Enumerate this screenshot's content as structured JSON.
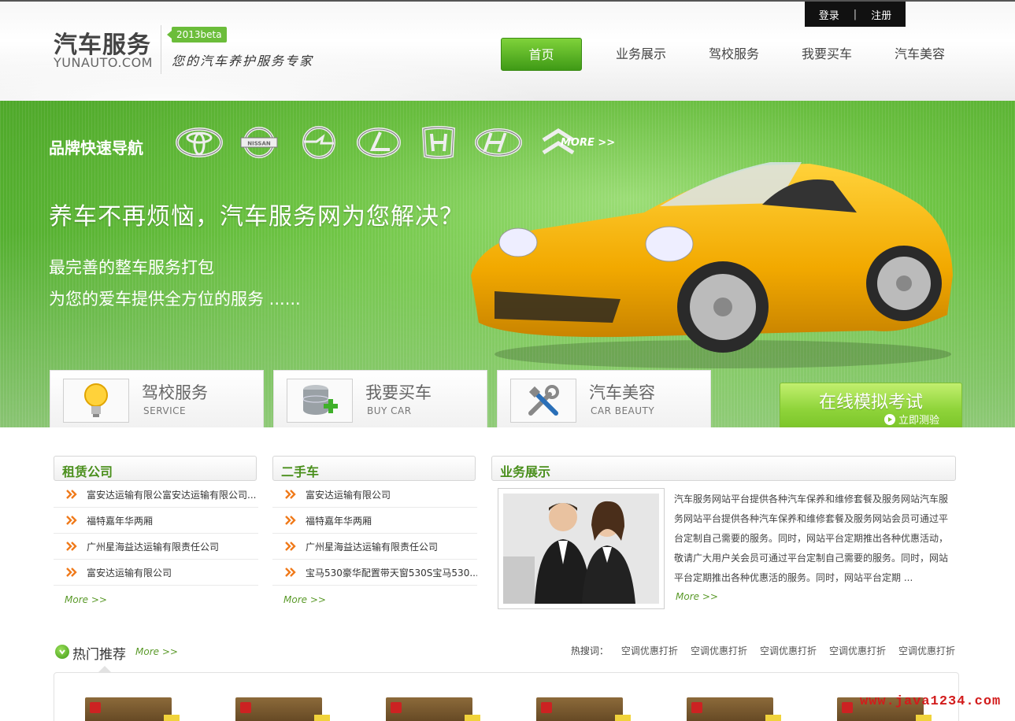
{
  "header": {
    "logo_title": "汽车服务",
    "logo_sub": "YUNAUTO.COM",
    "beta": "2013beta",
    "slogan": "您的汽车养护服务专家",
    "auth": {
      "login": "登录",
      "separator": "|",
      "register": "注册"
    },
    "nav": [
      "首页",
      "业务展示",
      "驾校服务",
      "我要买车",
      "汽车美容"
    ]
  },
  "banner": {
    "brand_title": "品牌快速导航",
    "brand_more": "MORE >>",
    "brands": [
      "toyota-logo-icon",
      "nissan-logo-icon",
      "opel-logo-icon",
      "lexus-logo-icon",
      "honda-logo-icon",
      "hyundai-logo-icon",
      "citroen-logo-icon"
    ],
    "nissan_word": "NISSAN",
    "headline": "养车不再烦恼，汽车服务网为您解决？",
    "line1": "最完善的整车服务打包",
    "line2": "为您的爱车提供全方位的服务 ......",
    "services": [
      {
        "title": "驾校服务",
        "sub": "SERVICE",
        "icon": "lightbulb-icon"
      },
      {
        "title": "我要买车",
        "sub": "BUY CAR",
        "icon": "database-add-icon"
      },
      {
        "title": "汽车美容",
        "sub": "CAR BEAUTY",
        "icon": "tools-icon"
      }
    ],
    "exam": {
      "title": "在线模拟考试",
      "sub": "立即测验"
    }
  },
  "rental": {
    "title": "租赁公司",
    "items": [
      "富安达运输有限公富安达运输有限公司...",
      "福特嘉年华两厢",
      "广州星海益达运输有限责任公司",
      "富安达运输有限公司"
    ],
    "more": "More >>"
  },
  "used_car": {
    "title": "二手车",
    "items": [
      "富安达运输有限公司",
      "福特嘉年华两厢",
      "广州星海益达运输有限责任公司",
      "宝马530豪华配置带天窗530S宝马530..."
    ],
    "more": "More >>"
  },
  "business": {
    "title": "业务展示",
    "text": "汽车服务网站平台提供各种汽车保养和维修套餐及服务网站汽车服务网站平台提供各种汽车保养和维修套餐及服务网站会员可通过平台定制自己需要的服务。同时，网站平台定期推出各种优惠活动，敬请广大用户关会员可通过平台定制自己需要的服务。同时，网站平台定期推出各种优惠活的服务。同时，网站平台定期 ...",
    "more": "More >>"
  },
  "hot": {
    "title": "热门推荐",
    "more": "More >>",
    "keywords_label": "热搜词：",
    "keywords": [
      "空调优惠打折",
      "空调优惠打折",
      "空调优惠打折",
      "空调优惠打折",
      "空调优惠打折"
    ]
  },
  "watermark": "www.java1234.com",
  "colors": {
    "accent_green": "#5cb82e",
    "nav_active": "#4fae1f",
    "banner_car": "#f2a900"
  }
}
